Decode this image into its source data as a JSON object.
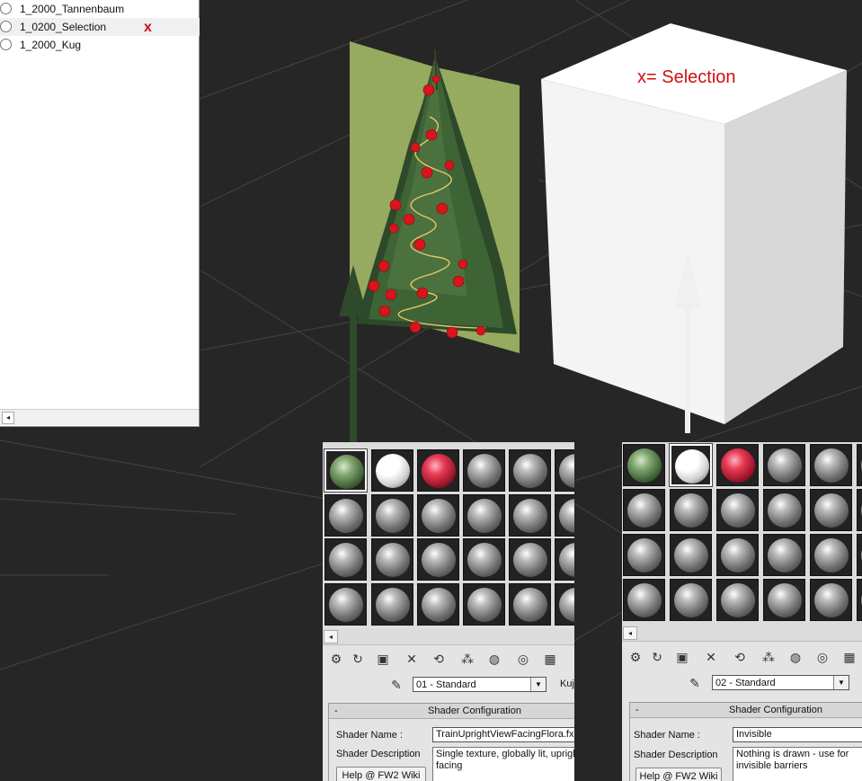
{
  "layers": [
    {
      "label": "1_2000_Tannenbaum"
    },
    {
      "label": "1_0200_Selection"
    },
    {
      "label": "1_2000_Kug"
    }
  ],
  "layer_marker": "x",
  "cube_label": "x=  Selection",
  "scroll_arrow": "◂",
  "material_editors": {
    "left": {
      "material_name": "01 - Standard",
      "type_button": "Kuj",
      "shader_config_title": "Shader Configuration",
      "collapse": "-",
      "shader_name_label": "Shader Name :",
      "shader_name_value": "TrainUprightViewFacingFlora.fx",
      "shader_desc_label": "Shader Description",
      "shader_desc_value": "Single texture, globally lit, upright facing",
      "help_label": "Help @ FW2 Wiki"
    },
    "right": {
      "material_name": "02 - Standard",
      "shader_config_title": "Shader Configuration",
      "collapse": "-",
      "shader_name_label": "Shader Name :",
      "shader_name_value": "Invisible",
      "shader_desc_label": "Shader Description",
      "shader_desc_value": "Nothing is drawn - use for invisible barriers",
      "help_label": "Help @ FW2 Wiki"
    }
  },
  "icons": [
    "get-material-icon",
    "put-to-scene-icon",
    "assign-material-icon",
    "delete-icon",
    "make-unique-icon",
    "put-to-library-icon",
    "material-id-icon",
    "show-in-viewport-icon",
    "background-icon",
    "eyedropper-icon"
  ],
  "colors": {
    "annotation_red": "#d01010",
    "viewport_bg": "#262626",
    "billboard_green": "#96ab5f"
  }
}
